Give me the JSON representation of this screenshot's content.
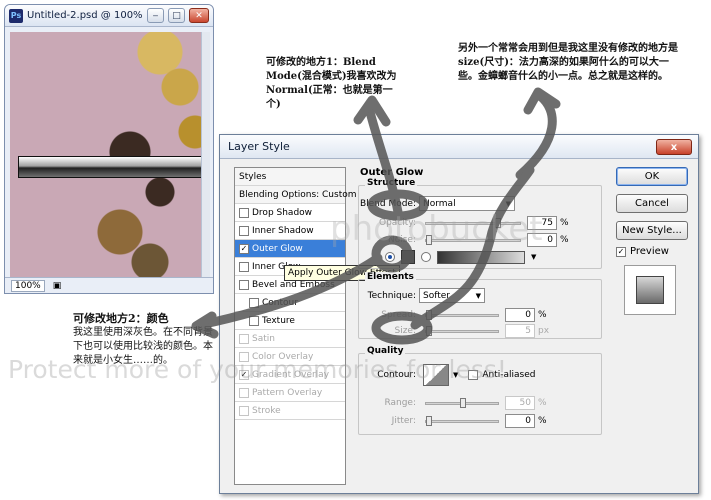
{
  "doc_window": {
    "title": "Untitled-2.psd @ 100% (...",
    "zoom": "100%"
  },
  "notes": {
    "note1": "可修改的地方1：Blend Mode(混合模式)我喜欢改为Normal(正常：也就是第一个)",
    "note2": "另外一个常常会用到但是我这里没有修改的地方是size(尺寸)：法力高深的如果阿什么的可以大一些。金蟑螂音什么的小一点。总之就是这样的。",
    "note3_head": "可修改地方2：颜色",
    "note3_body": "我这里使用深灰色。在不同背景下也可以使用比较浅的颜色。本来就是小女生……的。"
  },
  "dialog": {
    "title": "Layer Style",
    "close_label": "x",
    "styles": [
      {
        "label": "Styles",
        "type": "header"
      },
      {
        "label": "Blending Options: Custom",
        "type": "header"
      },
      {
        "label": "Drop Shadow",
        "checked": false
      },
      {
        "label": "Inner Shadow",
        "checked": false
      },
      {
        "label": "Outer Glow",
        "checked": true,
        "selected": true
      },
      {
        "label": "Inner Glow",
        "checked": false
      },
      {
        "label": "Bevel and Emboss",
        "checked": false
      },
      {
        "label": "Contour",
        "checked": false,
        "indent": true
      },
      {
        "label": "Texture",
        "checked": false,
        "indent": true
      },
      {
        "label": "Satin",
        "checked": false,
        "disabled": true
      },
      {
        "label": "Color Overlay",
        "checked": false,
        "disabled": true
      },
      {
        "label": "Gradient Overlay",
        "checked": true,
        "disabled": true
      },
      {
        "label": "Pattern Overlay",
        "checked": false,
        "disabled": true
      },
      {
        "label": "Stroke",
        "checked": false,
        "disabled": true
      }
    ],
    "tooltip": "Apply Outer Glow Effect",
    "panel_title": "Outer Glow",
    "structure": {
      "title": "Structure",
      "blend_mode_label": "Blend Mode:",
      "blend_mode_value": "Normal",
      "opacity_label": "Opacity:",
      "opacity_value": "75",
      "opacity_level": 0.75,
      "noise_label": "Noise:",
      "noise_value": "0",
      "noise_level": 0,
      "percent": "%",
      "color": "#555555"
    },
    "elements": {
      "title": "Elements",
      "technique_label": "Technique:",
      "technique_value": "Softer",
      "spread_label": "Spread:",
      "spread_value": "0",
      "spread_level": 0,
      "size_label": "Size:",
      "size_value": "5",
      "size_level": 0.02,
      "percent": "%",
      "px": "px"
    },
    "quality": {
      "title": "Quality",
      "contour_label": "Contour:",
      "anti_aliased_label": "Anti-aliased",
      "range_label": "Range:",
      "range_value": "50",
      "range_level": 0.5,
      "jitter_label": "Jitter:",
      "jitter_value": "0",
      "jitter_level": 0,
      "percent": "%"
    },
    "buttons": {
      "ok": "OK",
      "cancel": "Cancel",
      "new_style": "New Style...",
      "preview_label": "Preview"
    }
  }
}
